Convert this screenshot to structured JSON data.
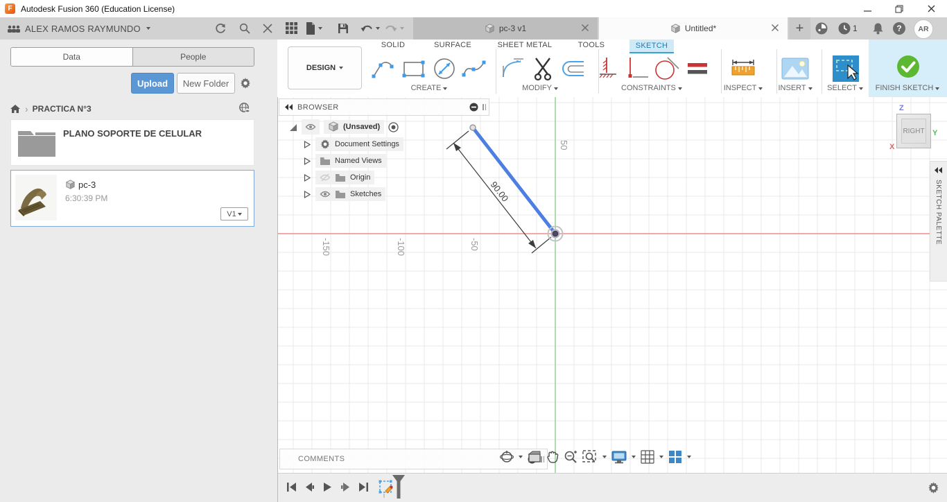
{
  "window": {
    "title": "Autodesk Fusion 360 (Education License)",
    "logo_letter": "F"
  },
  "data_panel": {
    "header": {
      "username": "ALEX RAMOS RAYMUNDO"
    },
    "tabs": {
      "data": "Data",
      "people": "People"
    },
    "actions": {
      "upload": "Upload",
      "new_folder": "New Folder"
    },
    "breadcrumb": {
      "separator": "›",
      "path": "PRACTICA N°3"
    },
    "folder": {
      "name": "PLANO SOPORTE DE CELULAR"
    },
    "file": {
      "name": "pc-3",
      "time": "6:30:39 PM",
      "version": "V1"
    }
  },
  "topbar": {
    "tabs": [
      {
        "label": "pc-3 v1"
      },
      {
        "label": "Untitled*"
      }
    ],
    "new_tab_glyph": "+",
    "job_count": "1",
    "help_glyph": "?",
    "avatar_initials": "AR"
  },
  "ribbon": {
    "workspace": "DESIGN",
    "tabs": [
      {
        "label": "SOLID"
      },
      {
        "label": "SURFACE"
      },
      {
        "label": "SHEET METAL"
      },
      {
        "label": "TOOLS"
      },
      {
        "label": "SKETCH"
      }
    ],
    "active_tab": "SKETCH",
    "groups": [
      {
        "label": "CREATE"
      },
      {
        "label": "MODIFY"
      },
      {
        "label": "CONSTRAINTS"
      },
      {
        "label": "INSPECT"
      },
      {
        "label": "INSERT"
      },
      {
        "label": "SELECT"
      },
      {
        "label": "FINISH SKETCH"
      }
    ]
  },
  "browser": {
    "title": "BROWSER",
    "root_label": "(Unsaved)",
    "items": [
      {
        "label": "Document Settings"
      },
      {
        "label": "Named Views"
      },
      {
        "label": "Origin"
      },
      {
        "label": "Sketches"
      }
    ]
  },
  "canvas": {
    "dimension_label": "90.00",
    "x_ticks": [
      {
        "label": "-150"
      },
      {
        "label": "-100"
      },
      {
        "label": "-50"
      }
    ],
    "y_ticks": [
      {
        "label": "50"
      }
    ],
    "viewcube": {
      "face": "RIGHT",
      "axis_x": "X",
      "axis_y": "Y",
      "axis_z": "Z"
    },
    "sketch_palette_label": "SKETCH PALETTE"
  },
  "comments": {
    "label": "COMMENTS"
  },
  "colors": {
    "accent_blue": "#5b97d4",
    "sketch_line": "#4d7fe3",
    "axis_red": "#ef8c8c",
    "axis_green": "#8ccf8c",
    "finish_green": "#5cb832",
    "active_tab_bg": "#cfe9f7",
    "select_tool_bg": "#2d8ecb"
  },
  "icons": {
    "help": "?",
    "browser_collapse": "◄◄",
    "palette_collapse": "◄◄"
  }
}
